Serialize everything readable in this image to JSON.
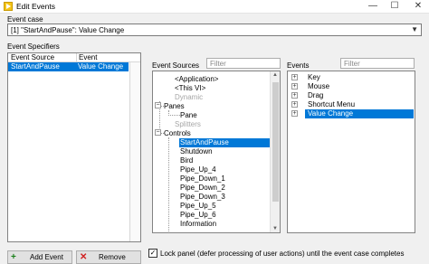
{
  "window": {
    "title": "Edit Events",
    "min": "—",
    "max": "☐",
    "close": "✕"
  },
  "event_case": {
    "label": "Event case",
    "value": "[1] \"StartAndPause\": Value Change"
  },
  "event_specifiers": {
    "label": "Event Specifiers",
    "columns": [
      "Event Source",
      "Event"
    ],
    "rows": [
      {
        "source": "StartAndPause",
        "event": "Value Change"
      }
    ]
  },
  "event_sources": {
    "label": "Event Sources",
    "filter_placeholder": "Filter",
    "items": [
      {
        "label": "<Application>",
        "dim": false,
        "selected": false
      },
      {
        "label": "<This VI>",
        "dim": false,
        "selected": false
      },
      {
        "label": "Dynamic",
        "dim": true,
        "selected": false
      },
      {
        "label": "Panes",
        "dim": false,
        "selected": false
      },
      {
        "label": "Pane",
        "dim": false,
        "selected": false
      },
      {
        "label": "Splitters",
        "dim": true,
        "selected": false
      },
      {
        "label": "Controls",
        "dim": false,
        "selected": false
      },
      {
        "label": "StartAndPause",
        "dim": false,
        "selected": true
      },
      {
        "label": "Shutdown",
        "dim": false,
        "selected": false
      },
      {
        "label": "Bird",
        "dim": false,
        "selected": false
      },
      {
        "label": "Pipe_Up_4",
        "dim": false,
        "selected": false
      },
      {
        "label": "Pipe_Down_1",
        "dim": false,
        "selected": false
      },
      {
        "label": "Pipe_Down_2",
        "dim": false,
        "selected": false
      },
      {
        "label": "Pipe_Down_3",
        "dim": false,
        "selected": false
      },
      {
        "label": "Pipe_Up_5",
        "dim": false,
        "selected": false
      },
      {
        "label": "Pipe_Up_6",
        "dim": false,
        "selected": false
      },
      {
        "label": "Information",
        "dim": false,
        "selected": false
      }
    ]
  },
  "events": {
    "label": "Events",
    "filter_placeholder": "Filter",
    "items": [
      {
        "label": "Key",
        "selected": false
      },
      {
        "label": "Mouse",
        "selected": false
      },
      {
        "label": "Drag",
        "selected": false
      },
      {
        "label": "Shortcut Menu",
        "selected": false
      },
      {
        "label": "Value Change",
        "selected": true
      }
    ]
  },
  "buttons": {
    "add": "Add Event",
    "add_icon": "+",
    "remove": "Remove",
    "remove_icon": "✕"
  },
  "lock_panel": {
    "checked": true,
    "check_mark": "✓",
    "label": "Lock panel (defer processing of user actions) until the event case completes"
  },
  "colors": {
    "selection": "#0078d7",
    "add_icon": "#1a7f1a",
    "remove_icon": "#d02020"
  }
}
